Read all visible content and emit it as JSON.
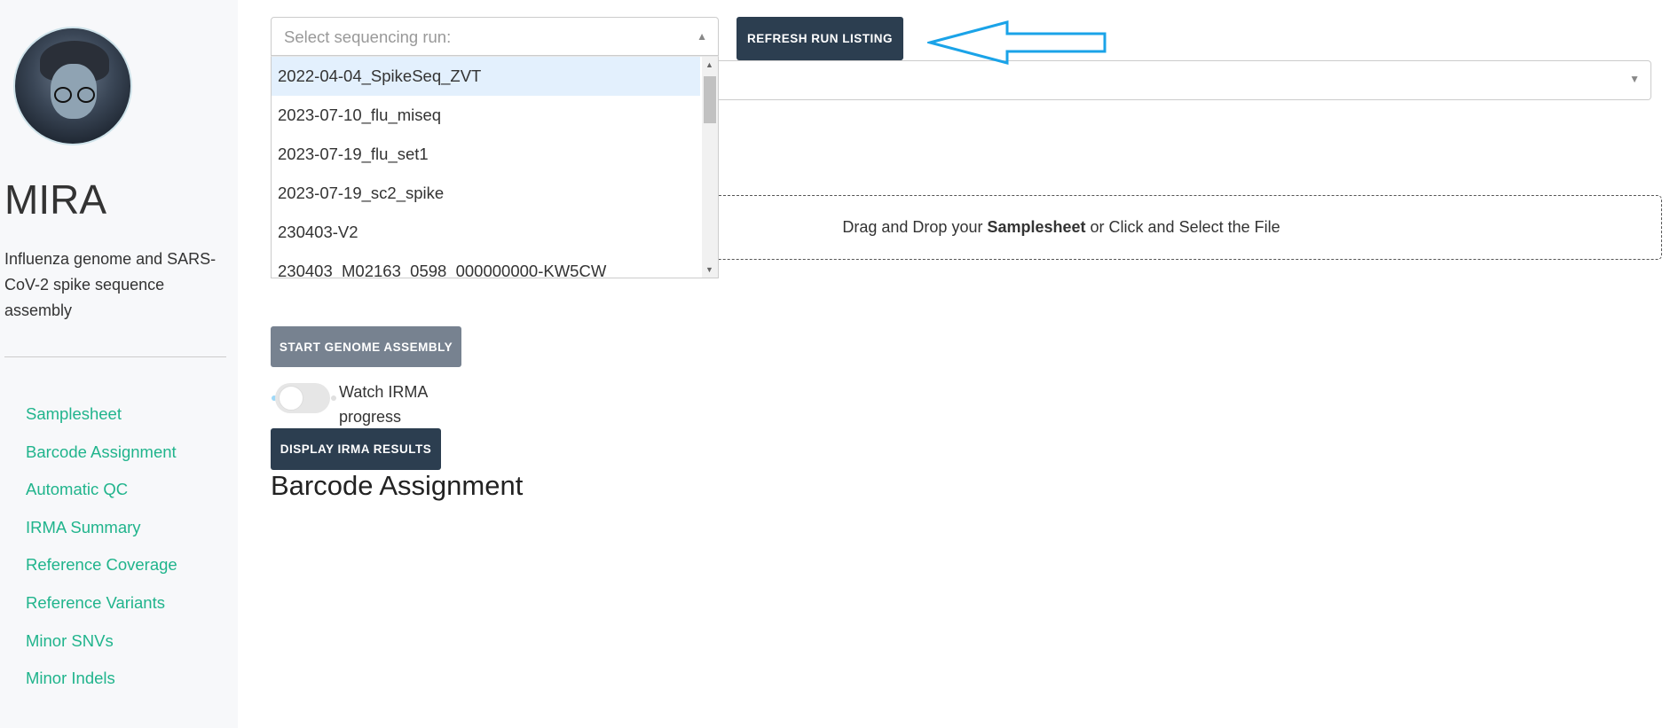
{
  "sidebar": {
    "title": "MIRA",
    "subtitle": "Influenza genome and SARS-CoV-2 spike sequence assembly",
    "nav": [
      "Samplesheet",
      "Barcode Assignment",
      "Automatic QC",
      "IRMA Summary",
      "Reference Coverage",
      "Reference Variants",
      "Minor SNVs",
      "Minor Indels"
    ]
  },
  "run_select": {
    "placeholder": "Select sequencing run:",
    "options": [
      "2022-04-04_SpikeSeq_ZVT",
      "2023-07-10_flu_miseq",
      "2023-07-19_flu_set1",
      "2023-07-19_sc2_spike",
      "230403-V2",
      "230403_M02163_0598_000000000-KW5CW"
    ],
    "highlighted": "2022-04-04_SpikeSeq_ZVT"
  },
  "refresh_label": "REFRESH RUN LISTING",
  "upload": {
    "pre": "Drag and Drop your",
    "bold": "Samplesheet",
    "post": "or Click and Select the File"
  },
  "start_label": "START GENOME ASSEMBLY",
  "toggle": {
    "label": "Watch IRMA progress",
    "on": false
  },
  "display_label": "DISPLAY IRMA RESULTS",
  "section_heading": "Barcode Assignment",
  "colors": {
    "nav": "#20b48c",
    "dark_button": "#2c3e50",
    "grey_button": "#778290",
    "arrow": "#1aa3e8"
  }
}
